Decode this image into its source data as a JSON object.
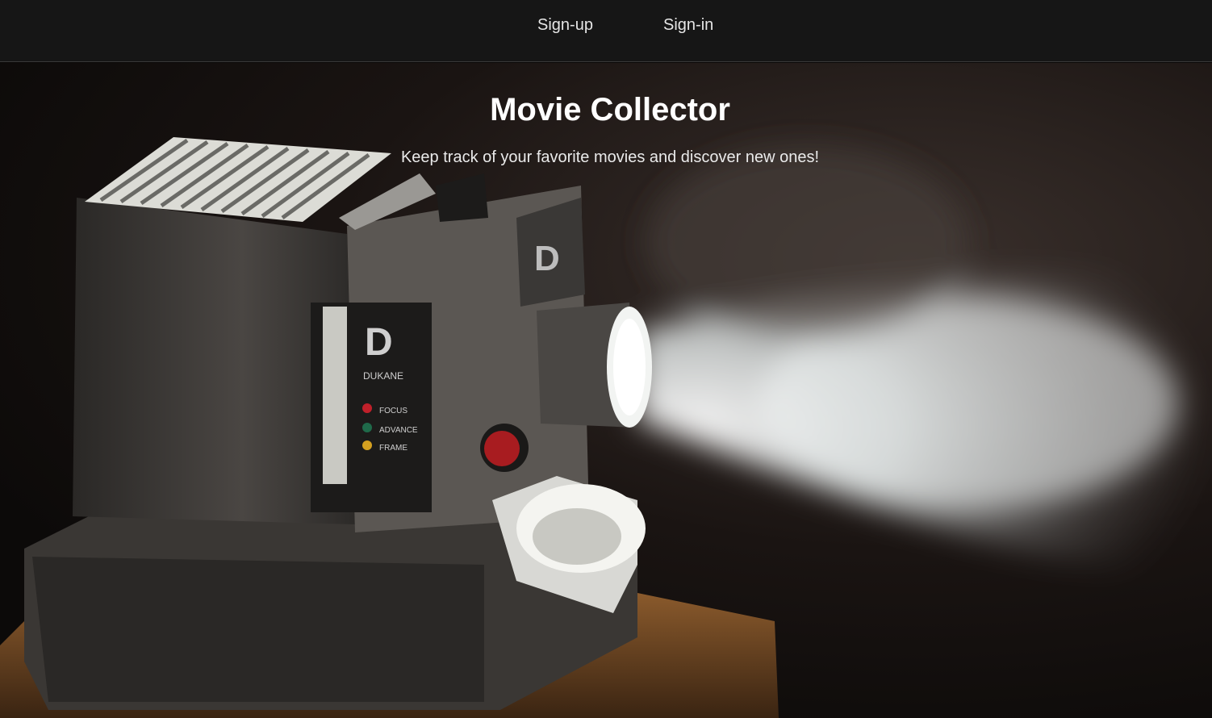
{
  "nav": {
    "signup_label": "Sign-up",
    "signin_label": "Sign-in"
  },
  "hero": {
    "title": "Movie Collector",
    "subtitle": "Keep track of your favorite movies and discover new ones!",
    "image": {
      "brand_text": "DUKANE",
      "controls": [
        "FOCUS",
        "ADVANCE",
        "FRAME"
      ]
    }
  },
  "colors": {
    "navbar_bg": "#161616",
    "nav_text": "#e6e6e6",
    "title_text": "#ffffff"
  }
}
